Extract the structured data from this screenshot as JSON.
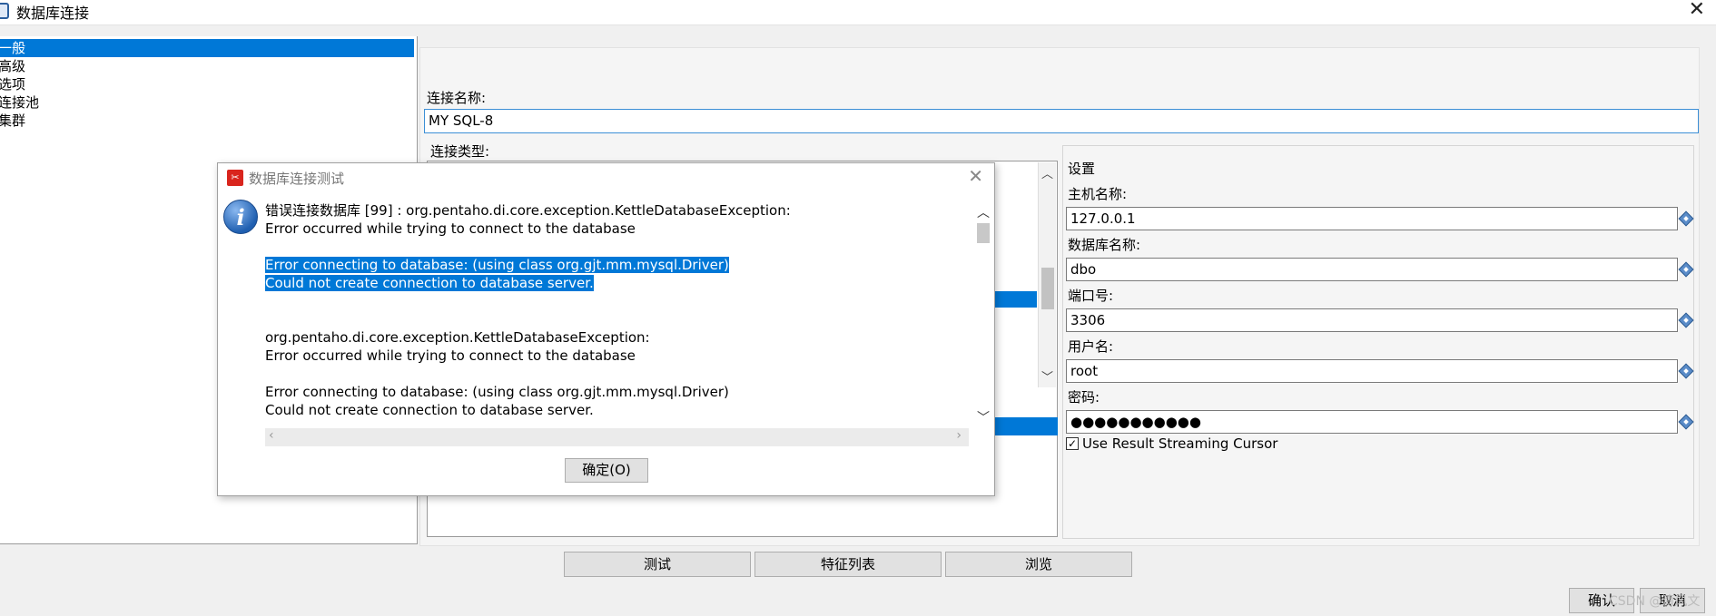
{
  "window": {
    "title": "数据库连接",
    "close_glyph": "✕"
  },
  "nav": {
    "items": [
      {
        "label": "一般",
        "selected": true
      },
      {
        "label": "高级",
        "selected": false
      },
      {
        "label": "选项",
        "selected": false
      },
      {
        "label": "连接池",
        "selected": false
      },
      {
        "label": "集群",
        "selected": false
      }
    ]
  },
  "general": {
    "connection_name_label": "连接名称:",
    "connection_name_value": "MY SQL-8",
    "connection_type_label": "连接类型:"
  },
  "settings": {
    "title": "设置",
    "host_label": "主机名称:",
    "host_value": "127.0.0.1",
    "db_label": "数据库名称:",
    "db_value": "dbo",
    "port_label": "端口号:",
    "port_value": "3306",
    "user_label": "用户名:",
    "user_value": "root",
    "password_label": "密码:",
    "password_value": "●●●●●●●●●●●",
    "streaming_checked": true,
    "streaming_label": "Use Result Streaming Cursor"
  },
  "bottom_buttons": {
    "test": "测试",
    "features": "特征列表",
    "browse": "浏览",
    "ok": "确认",
    "cancel": "取消"
  },
  "watermark": "CSDN @清风文",
  "dialog": {
    "title": "数据库连接测试",
    "close_glyph": "✕",
    "icon": "info-icon",
    "lines": [
      {
        "text": "错误连接数据库 [99] : org.pentaho.di.core.exception.KettleDatabaseException:",
        "highlight": false
      },
      {
        "text": "Error occurred while trying to connect to the database",
        "highlight": false
      },
      {
        "text": "",
        "highlight": false
      },
      {
        "text": "Error connecting to database: (using class org.gjt.mm.mysql.Driver) ",
        "highlight": true
      },
      {
        "text": "Could not create connection to database server.",
        "highlight": true
      },
      {
        "text": "",
        "highlight": false
      },
      {
        "text": "",
        "highlight": false
      },
      {
        "text": "org.pentaho.di.core.exception.KettleDatabaseException:",
        "highlight": false
      },
      {
        "text": "Error occurred while trying to connect to the database",
        "highlight": false
      },
      {
        "text": "",
        "highlight": false
      },
      {
        "text": "Error connecting to database: (using class org.gjt.mm.mysql.Driver)",
        "highlight": false
      },
      {
        "text": "Could not create connection to database server.",
        "highlight": false
      }
    ],
    "ok_label": "确定(O)"
  }
}
